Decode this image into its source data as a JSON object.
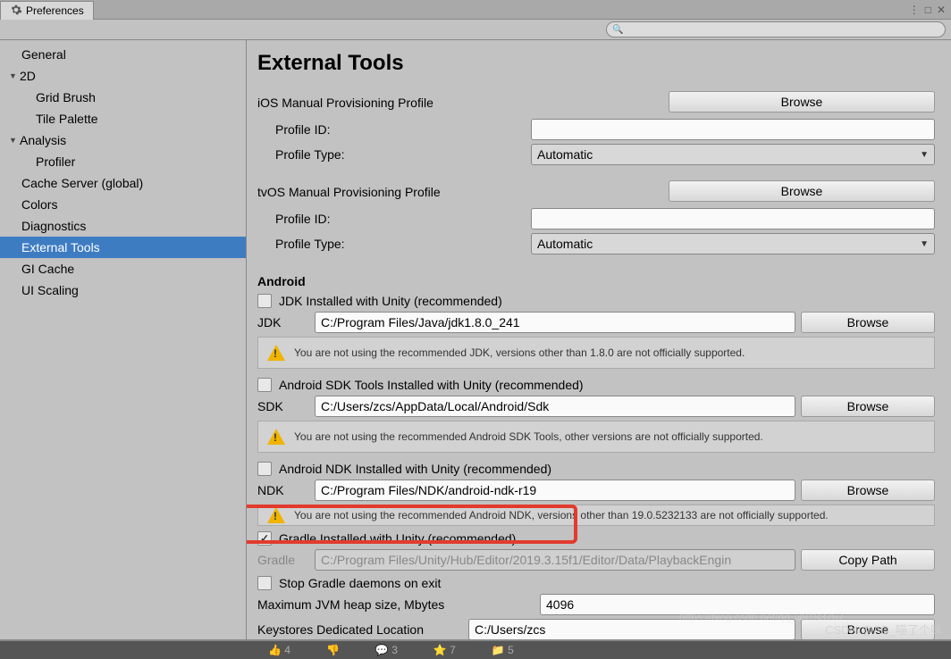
{
  "window": {
    "title": "Preferences"
  },
  "sidebar": {
    "items": [
      {
        "label": "General",
        "type": "item"
      },
      {
        "label": "2D",
        "type": "parent",
        "expanded": true
      },
      {
        "label": "Grid Brush",
        "type": "child"
      },
      {
        "label": "Tile Palette",
        "type": "child"
      },
      {
        "label": "Analysis",
        "type": "parent",
        "expanded": true
      },
      {
        "label": "Profiler",
        "type": "child"
      },
      {
        "label": "Cache Server (global)",
        "type": "item"
      },
      {
        "label": "Colors",
        "type": "item"
      },
      {
        "label": "Diagnostics",
        "type": "item"
      },
      {
        "label": "External Tools",
        "type": "item",
        "selected": true
      },
      {
        "label": "GI Cache",
        "type": "item"
      },
      {
        "label": "UI Scaling",
        "type": "item"
      }
    ]
  },
  "content": {
    "heading": "External Tools",
    "ios": {
      "section": "iOS Manual Provisioning Profile",
      "browse": "Browse",
      "profile_id_label": "Profile ID:",
      "profile_id_value": "",
      "profile_type_label": "Profile Type:",
      "profile_type_value": "Automatic"
    },
    "tvos": {
      "section": "tvOS Manual Provisioning Profile",
      "browse": "Browse",
      "profile_id_label": "Profile ID:",
      "profile_id_value": "",
      "profile_type_label": "Profile Type:",
      "profile_type_value": "Automatic"
    },
    "android": {
      "heading": "Android",
      "jdk_check_label": "JDK Installed with Unity (recommended)",
      "jdk_label": "JDK",
      "jdk_path": "C:/Program Files/Java/jdk1.8.0_241",
      "jdk_browse": "Browse",
      "jdk_warn": "You are not using the recommended JDK, versions other than 1.8.0 are not officially supported.",
      "sdk_check_label": "Android SDK Tools Installed with Unity (recommended)",
      "sdk_label": "SDK",
      "sdk_path": "C:/Users/zcs/AppData/Local/Android/Sdk",
      "sdk_browse": "Browse",
      "sdk_warn": "You are not using the recommended Android SDK Tools, other versions are not officially supported.",
      "ndk_check_label": "Android NDK Installed with Unity (recommended)",
      "ndk_label": "NDK",
      "ndk_path": "C:/Program Files/NDK/android-ndk-r19",
      "ndk_browse": "Browse",
      "ndk_warn": "You are not using the recommended Android NDK, versions other than 19.0.5232133 are not officially supported.",
      "gradle_check_label": "Gradle Installed with Unity (recommended)",
      "gradle_label": "Gradle",
      "gradle_path": "C:/Program Files/Unity/Hub/Editor/2019.3.15f1/Editor/Data/PlaybackEngin",
      "gradle_copy": "Copy Path",
      "stop_daemons_label": "Stop Gradle daemons on exit",
      "jvm_heap_label": "Maximum JVM heap size, Mbytes",
      "jvm_heap_value": "4096",
      "keystore_label": "Keystores Dedicated Location",
      "keystore_value": "C:/Users/zcs",
      "keystore_browse": "Browse"
    }
  },
  "bottom": {
    "n1": "4",
    "n2": "3",
    "n3": "7",
    "n4": "5"
  },
  "watermark": "CSDN @AD_喵了个咪",
  "watermark2": "https://blog.csdn.net/qq_39193767"
}
